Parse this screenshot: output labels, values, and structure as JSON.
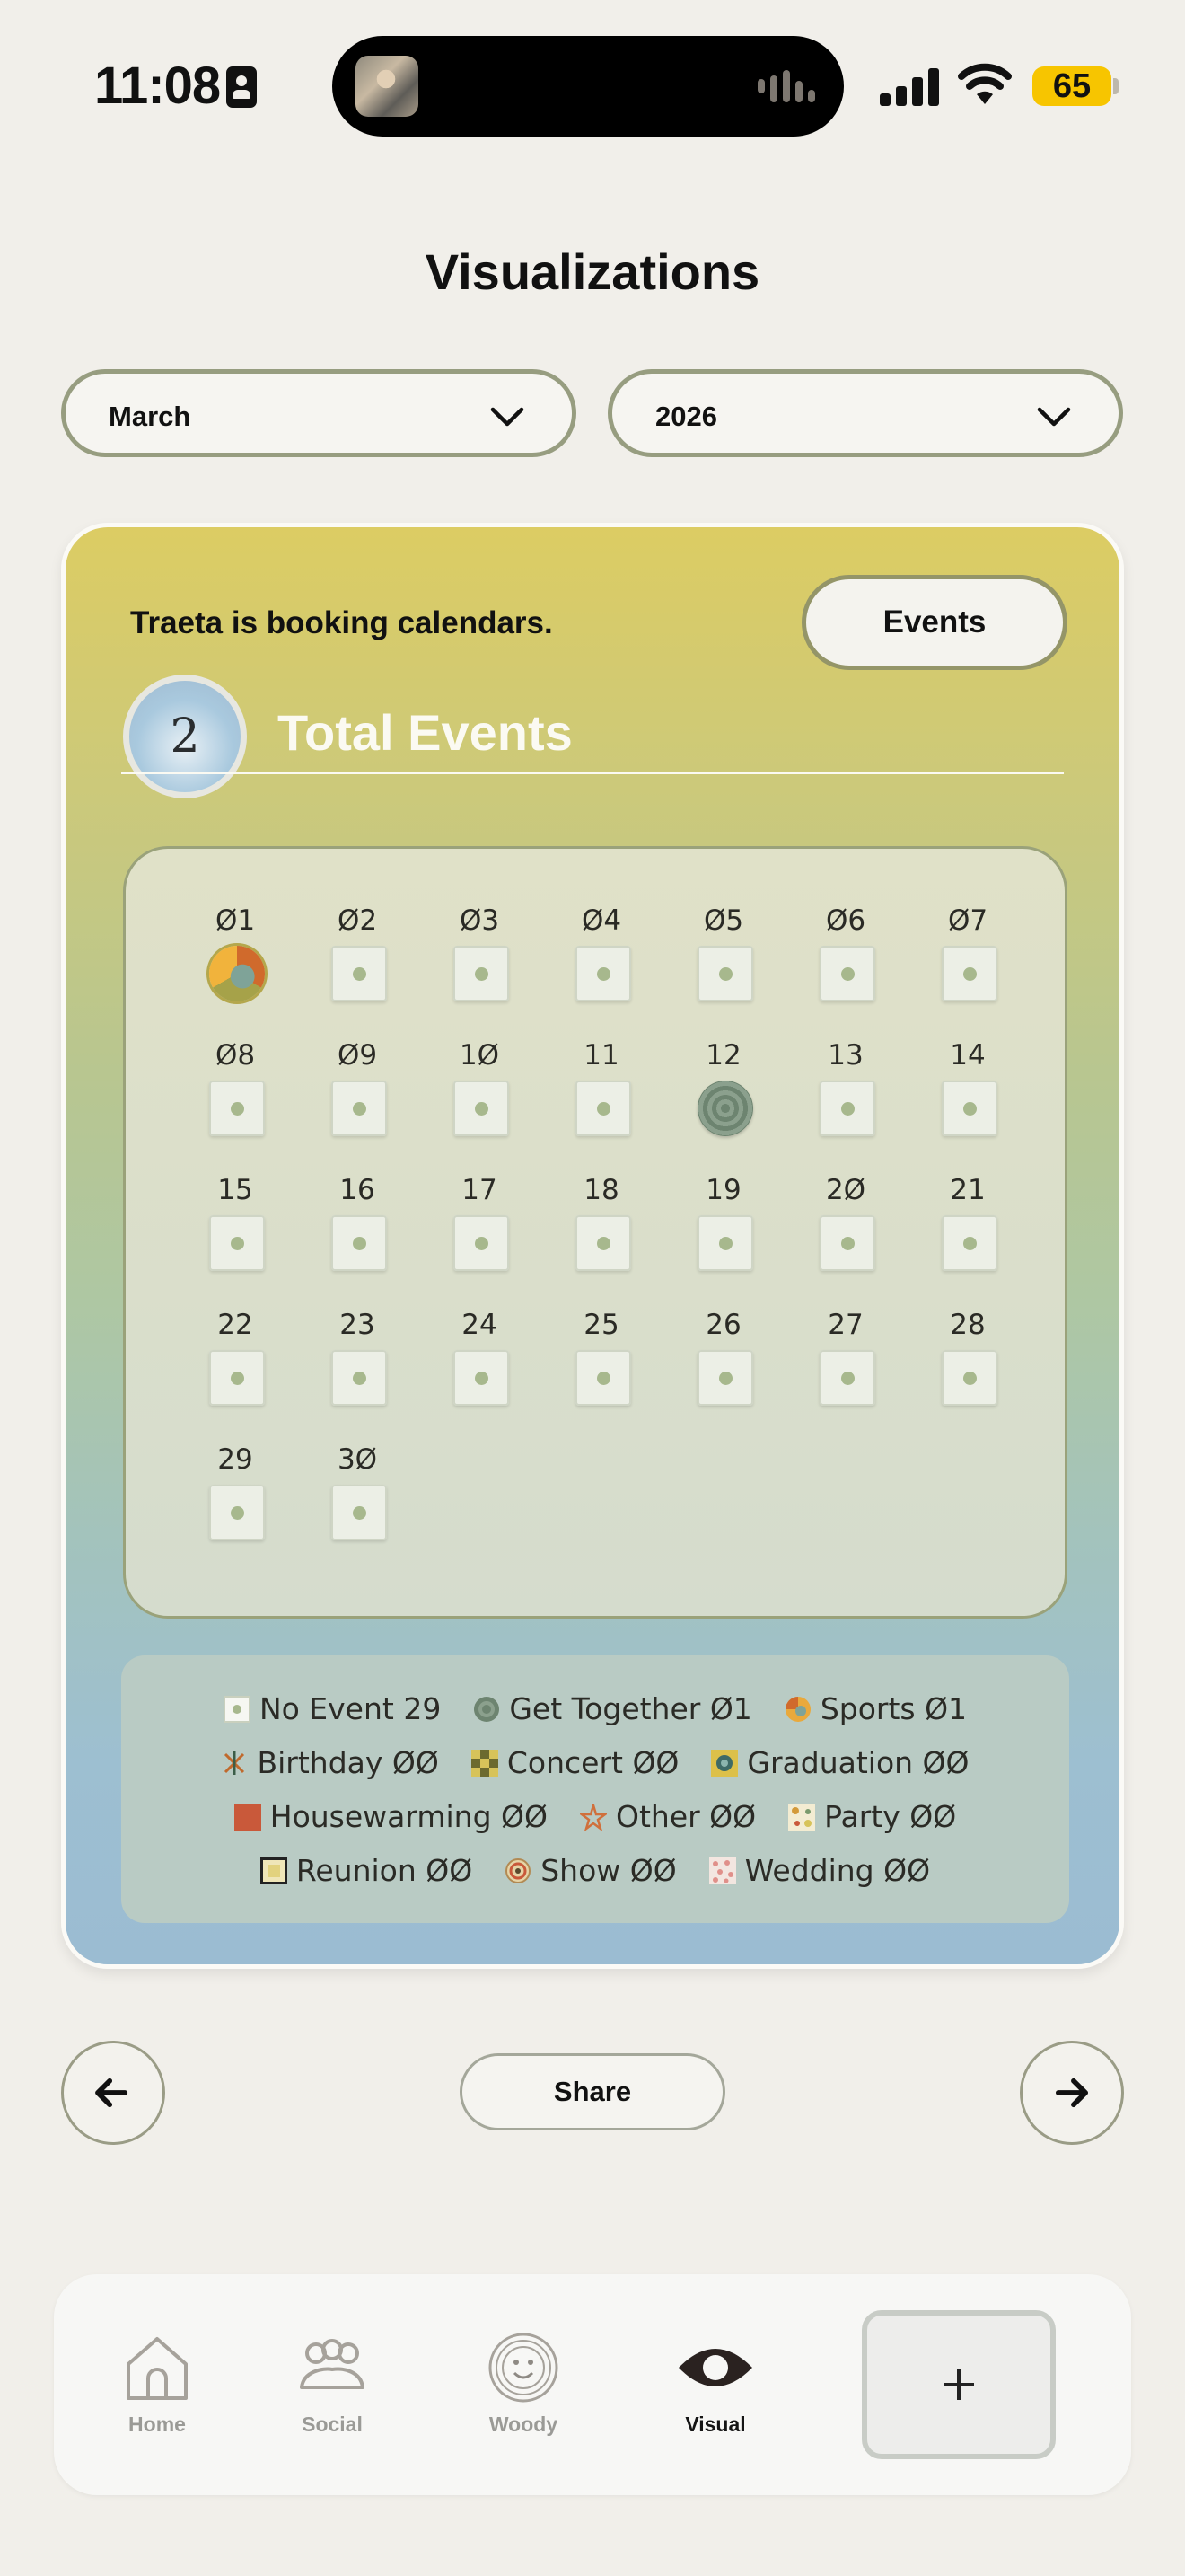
{
  "status_bar": {
    "time": "11:08",
    "battery": "65",
    "icons": [
      "contact-card-icon",
      "audio-wave-icon",
      "cellular-signal-icon",
      "wifi-icon",
      "battery-icon"
    ]
  },
  "page": {
    "title": "Visualizations"
  },
  "filters": {
    "month": "March",
    "year": "2026"
  },
  "card": {
    "booking_text": "Traeta is booking calendars.",
    "events_button": "Events",
    "total_count": "2",
    "total_label": "Total Events"
  },
  "calendar": {
    "days": [
      {
        "label": "Ø1",
        "type": "sports"
      },
      {
        "label": "Ø2",
        "type": "none"
      },
      {
        "label": "Ø3",
        "type": "none"
      },
      {
        "label": "Ø4",
        "type": "none"
      },
      {
        "label": "Ø5",
        "type": "none"
      },
      {
        "label": "Ø6",
        "type": "none"
      },
      {
        "label": "Ø7",
        "type": "none"
      },
      {
        "label": "Ø8",
        "type": "none"
      },
      {
        "label": "Ø9",
        "type": "none"
      },
      {
        "label": "1Ø",
        "type": "none"
      },
      {
        "label": "11",
        "type": "none"
      },
      {
        "label": "12",
        "type": "get-together"
      },
      {
        "label": "13",
        "type": "none"
      },
      {
        "label": "14",
        "type": "none"
      },
      {
        "label": "15",
        "type": "none"
      },
      {
        "label": "16",
        "type": "none"
      },
      {
        "label": "17",
        "type": "none"
      },
      {
        "label": "18",
        "type": "none"
      },
      {
        "label": "19",
        "type": "none"
      },
      {
        "label": "2Ø",
        "type": "none"
      },
      {
        "label": "21",
        "type": "none"
      },
      {
        "label": "22",
        "type": "none"
      },
      {
        "label": "23",
        "type": "none"
      },
      {
        "label": "24",
        "type": "none"
      },
      {
        "label": "25",
        "type": "none"
      },
      {
        "label": "26",
        "type": "none"
      },
      {
        "label": "27",
        "type": "none"
      },
      {
        "label": "28",
        "type": "none"
      },
      {
        "label": "29",
        "type": "none"
      },
      {
        "label": "3Ø",
        "type": "none"
      }
    ]
  },
  "legend": {
    "rows": [
      [
        {
          "icon": "no-event-icon",
          "label": "No  Event 29"
        },
        {
          "icon": "get-together-icon",
          "label": "Get  Together Ø1"
        },
        {
          "icon": "sports-icon",
          "label": "Sports Ø1"
        }
      ],
      [
        {
          "icon": "birthday-icon",
          "label": "Birthday ØØ"
        },
        {
          "icon": "concert-icon",
          "label": "Concert ØØ"
        },
        {
          "icon": "graduation-icon",
          "label": "Graduation ØØ"
        }
      ],
      [
        {
          "icon": "housewarming-icon",
          "label": "Housewarming ØØ"
        },
        {
          "icon": "other-icon",
          "label": "Other ØØ"
        },
        {
          "icon": "party-icon",
          "label": "Party ØØ"
        }
      ],
      [
        {
          "icon": "reunion-icon",
          "label": "Reunion ØØ"
        },
        {
          "icon": "show-icon",
          "label": "Show ØØ"
        },
        {
          "icon": "wedding-icon",
          "label": "Wedding ØØ"
        }
      ]
    ]
  },
  "actions": {
    "share": "Share"
  },
  "tabs": [
    {
      "label": "Home",
      "icon": "home-icon"
    },
    {
      "label": "Social",
      "icon": "people-icon"
    },
    {
      "label": "Woody",
      "icon": "wood-face-icon"
    },
    {
      "label": "Visual",
      "icon": "eye-icon"
    }
  ],
  "colors": {
    "card_gradient_top": "#dccc63",
    "card_gradient_bottom": "#9bbcd2",
    "battery": "#f7c500",
    "select_border": "#979d80"
  }
}
